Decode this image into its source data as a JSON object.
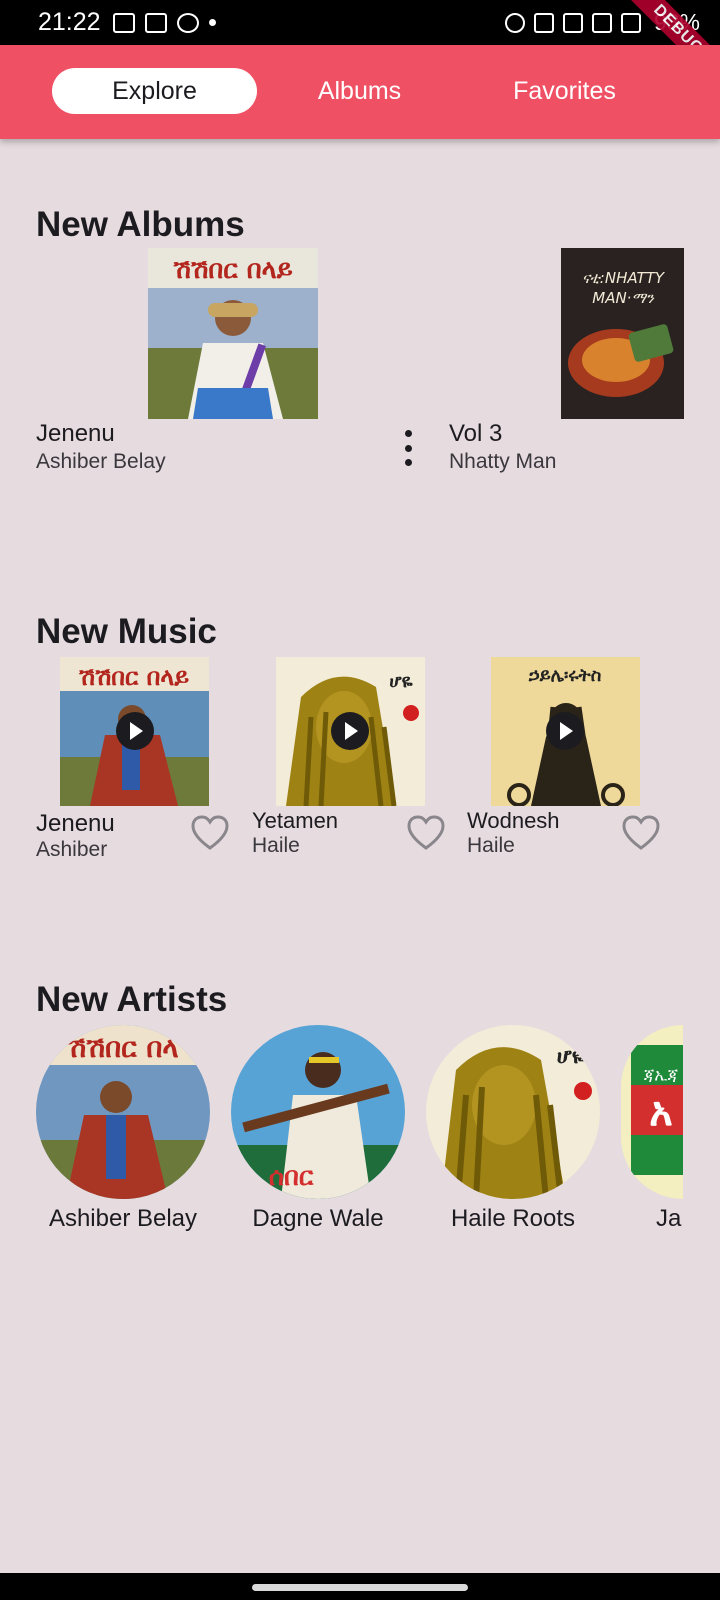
{
  "status_bar": {
    "time": "21:22",
    "battery": "93%"
  },
  "debug_banner": "DEBUG",
  "tabs": [
    {
      "label": "Explore",
      "active": true
    },
    {
      "label": "Albums",
      "active": false
    },
    {
      "label": "Favorites",
      "active": false
    }
  ],
  "new_albums": {
    "title": "New Albums",
    "items": [
      {
        "title": "Jenenu",
        "artist": "Ashiber Belay"
      },
      {
        "title": "Vol 3",
        "artist": "Nhatty Man"
      }
    ]
  },
  "new_music": {
    "title": "New Music",
    "items": [
      {
        "title": "Jenenu",
        "artist": "Ashiber"
      },
      {
        "title": "Yetamen",
        "artist": "Haile"
      },
      {
        "title": "Wodnesh",
        "artist": "Haile"
      }
    ]
  },
  "new_artists": {
    "title": "New Artists",
    "items": [
      {
        "name": "Ashiber Belay"
      },
      {
        "name": "Dagne Wale"
      },
      {
        "name": "Haile Roots"
      },
      {
        "name": "Ja"
      }
    ]
  },
  "colors": {
    "accent": "#ef5064",
    "background": "#e6dbdf"
  }
}
